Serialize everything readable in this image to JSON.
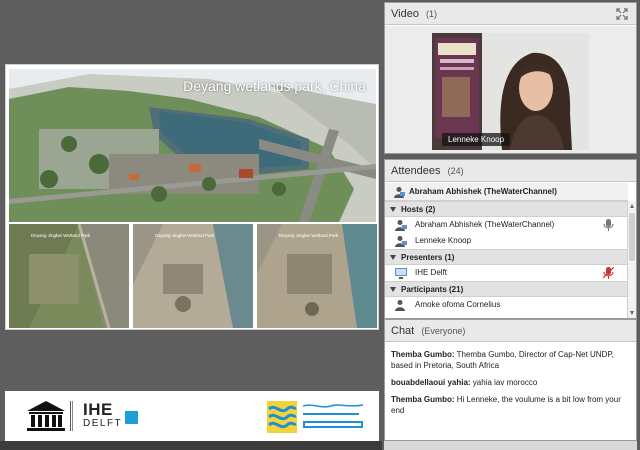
{
  "slide": {
    "title": "Deyang wetlands park, China",
    "sat_labels": [
      "Deyang Jingbei Wetland Park",
      "Deyang Jingbei Wetland Park",
      "Deyang Jingbei Wetland Park"
    ]
  },
  "logos": {
    "ihe_name": "IHE",
    "ihe_sub": "DELFT",
    "ihe_color": "#1a9fd6",
    "watercolor_brand": "#1f8fd8"
  },
  "video": {
    "title": "Video",
    "count": "(1)",
    "presenter_name": "Lenneke Knoop"
  },
  "attendees": {
    "title": "Attendees",
    "count": "(24)",
    "me": "Abraham Abhishek (TheWaterChannel)",
    "groups": [
      {
        "label": "Hosts (2)",
        "people": [
          "Abraham Abhishek (TheWaterChannel)",
          "Lenneke Knoop"
        ]
      },
      {
        "label": "Presenters (1)",
        "people": [
          "IHE Delft"
        ]
      },
      {
        "label": "Participants (21)",
        "people": [
          "Amoke ofoma Cornelius"
        ]
      }
    ]
  },
  "chat": {
    "title": "Chat",
    "scope": "(Everyone)",
    "messages": [
      {
        "sender": "Themba Gumbo:",
        "text": " Themba Gumbo, Director of Cap-Net UNDP, based in Pretoria, South Africa"
      },
      {
        "sender": "bouabdellaoui yahia:",
        "text": " yahia iav morocco"
      },
      {
        "sender": "Themba Gumbo:",
        "text": " Hi Lenneke, the voulume is a bit low from your end"
      }
    ]
  }
}
